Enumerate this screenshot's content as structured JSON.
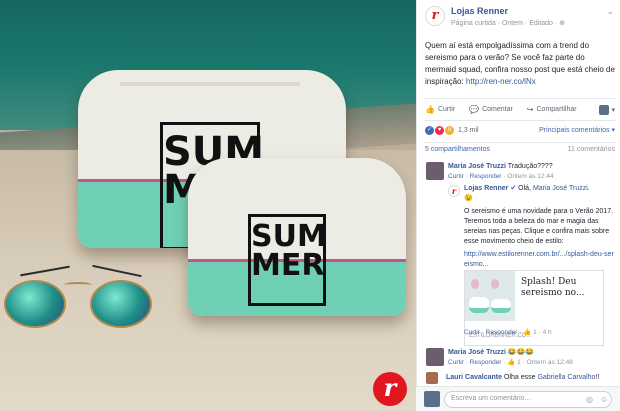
{
  "post": {
    "page_name": "Lojas Renner",
    "meta": "Página curtida · Ontem · Editado ·",
    "text": "Quem aí está empolgadíssima com a trend do sereismo para o verão? Se você faz parte do mermaid squad, confira nosso post que está cheio de inspiração: ",
    "link": "http://ren-ner.co/lNx"
  },
  "image": {
    "bag_label_line1": "SUM",
    "bag_label_line2": "MER",
    "bag_label_line1_front": "SUM",
    "bag_label_line2_front": "MER",
    "logo_letter": "r"
  },
  "actions": {
    "like": "Curtir",
    "comment": "Comentar",
    "share": "Compartilhar"
  },
  "reactions": {
    "count": "1,3 mil",
    "sort_label": "Principais comentários ▾"
  },
  "counts": {
    "shares": "5 compartilhamentos",
    "comments": "11 comentários"
  },
  "comments": [
    {
      "name": "Maria José Truzzi",
      "text": "Tradução????",
      "like": "Curtir",
      "reply": "Responder",
      "time": "Ontem às 12:44"
    },
    {
      "name": "Lojas Renner",
      "text_prefix": "Olá, ",
      "mention": "Maria José Truzzi",
      "text_suffix": ".",
      "emoji": "😉",
      "body": "O sereismo é uma novidade para o Verão 2017. Teremos toda a beleza do mar e magia das sereias nas peças. Clique e confira mais sobre esse movimento cheio de estilo:",
      "url": "http://www.estilorenner.com.br/.../splash-deu-sereismo...",
      "card_title": "Splash! Deu sereismo no...",
      "card_site": "ESTILORENNER.CO...",
      "like": "Curtir",
      "reply": "Responder",
      "likes": "1",
      "time": "4 h"
    },
    {
      "name": "Maria José Truzzi",
      "emojis": "😂😂😂",
      "like": "Curtir",
      "reply": "Responder",
      "likes": "1",
      "time": "Ontem às 12:48"
    },
    {
      "name": "Lauri Cavalcante",
      "text": "Olha esse ",
      "mention": "Gabriella Carvalho",
      "suffix": "!!"
    }
  ],
  "composer": {
    "placeholder": "Escreva um comentário..."
  },
  "colors": {
    "brand_red": "#e1161e",
    "link_blue": "#365899",
    "mint": "#6fd0b5"
  }
}
